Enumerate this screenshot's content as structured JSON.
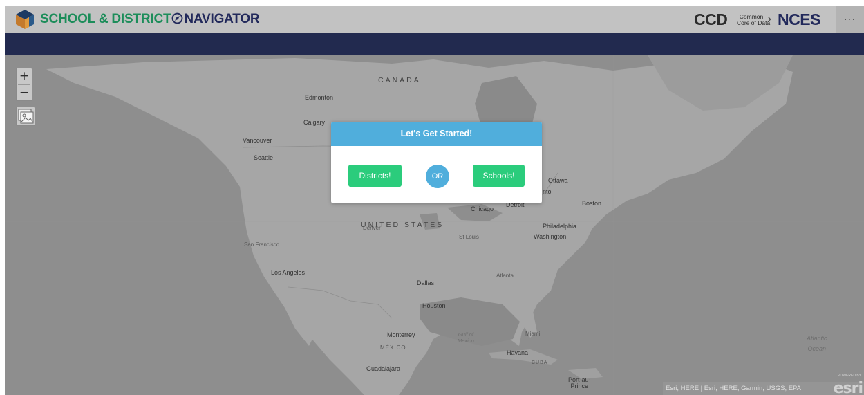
{
  "header": {
    "title_part_a": "SCHOOL & DISTRICT",
    "title_part_b": "NAVIGATOR",
    "ccd_label": "CCD",
    "ccd_sub_line1": "Common",
    "ccd_sub_line2": "Core of Data",
    "ccd_chevron": "›",
    "nces_label": "NCES",
    "more_label": "···",
    "colors": {
      "green": "#1c8d5a",
      "navy": "#22295b",
      "header_bg": "#c2c2c2",
      "navbar_bg": "#222a4f"
    }
  },
  "map": {
    "zoom_in": "+",
    "zoom_out": "−",
    "icons": {
      "basemap": "basemap-gallery-icon",
      "logo": "school-cube-icon",
      "compass": "compass-icon"
    },
    "labels": {
      "canada": "CANADA",
      "united_states": "UNITED STATES",
      "mexico": "MÉXICO",
      "cuba": "CUBA",
      "edmonton": "Edmonton",
      "calgary": "Calgary",
      "vancouver": "Vancouver",
      "seattle": "Seattle",
      "ottawa": "Ottawa",
      "toronto_fragment": "nto",
      "boston": "Boston",
      "detroit": "Detroit",
      "chicago": "Chicago",
      "denver": "Denver",
      "st_louis": "St Louis",
      "philadelphia": "Philadelphia",
      "washington": "Washington",
      "san_francisco": "San Francisco",
      "los_angeles": "Los Angeles",
      "dallas": "Dallas",
      "atlanta": "Atlanta",
      "houston": "Houston",
      "monterrey": "Monterrey",
      "miami": "Miami",
      "havana": "Havana",
      "guadalajara": "Guadalajara",
      "port_au_prince": "Port-au-\nPrince",
      "gulf_of_mexico": "Gulf of\nMexico",
      "atlantic_ocean": "Atlantic\nOcean"
    },
    "attribution": "Esri, HERE | Esri, HERE, Garmin, USGS, EPA",
    "esri_logo": "esri",
    "esri_powered": "POWERED BY"
  },
  "dialog": {
    "title": "Let's Get Started!",
    "districts_button": "Districts!",
    "or_label": "OR",
    "schools_button": "Schools!",
    "colors": {
      "accent": "#50aedc",
      "button": "#2bcc7c"
    }
  }
}
